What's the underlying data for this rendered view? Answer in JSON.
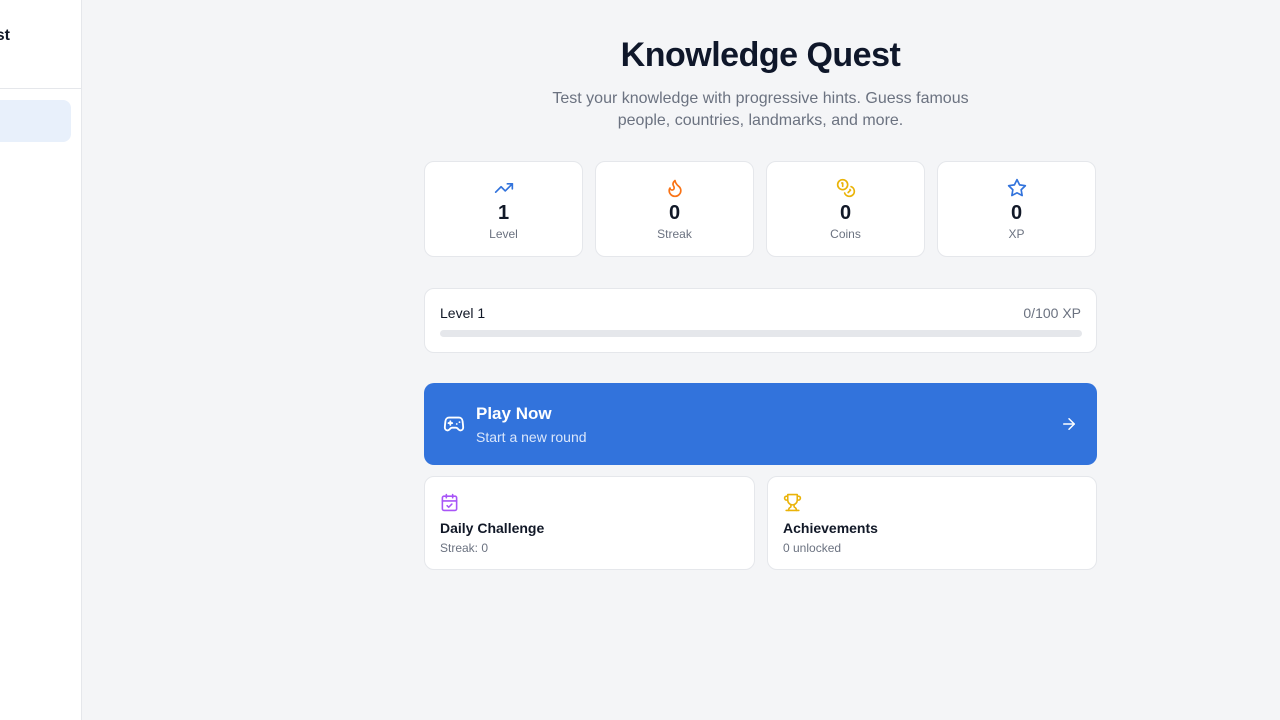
{
  "sidebar": {
    "title_fragment": "st"
  },
  "header": {
    "title": "Knowledge Quest",
    "subtitle": "Test your knowledge with progressive hints. Guess famous people, countries, landmarks, and more."
  },
  "stats": [
    {
      "icon": "trending-up-icon",
      "value": "1",
      "label": "Level",
      "color": "#3273dc"
    },
    {
      "icon": "flame-icon",
      "value": "0",
      "label": "Streak",
      "color": "#f97316"
    },
    {
      "icon": "coins-icon",
      "value": "0",
      "label": "Coins",
      "color": "#eab308"
    },
    {
      "icon": "star-icon",
      "value": "0",
      "label": "XP",
      "color": "#3273dc"
    }
  ],
  "progress": {
    "level_label": "Level 1",
    "xp_text": "0/100 XP",
    "fraction": 0
  },
  "play": {
    "title": "Play Now",
    "subtitle": "Start a new round",
    "color": "#3273dc"
  },
  "daily": {
    "title": "Daily Challenge",
    "subtitle": "Streak: 0",
    "icon": "calendar-check-icon",
    "color": "#a855f7"
  },
  "achievements": {
    "title": "Achievements",
    "subtitle": "0 unlocked",
    "icon": "trophy-icon",
    "color": "#eab308"
  }
}
